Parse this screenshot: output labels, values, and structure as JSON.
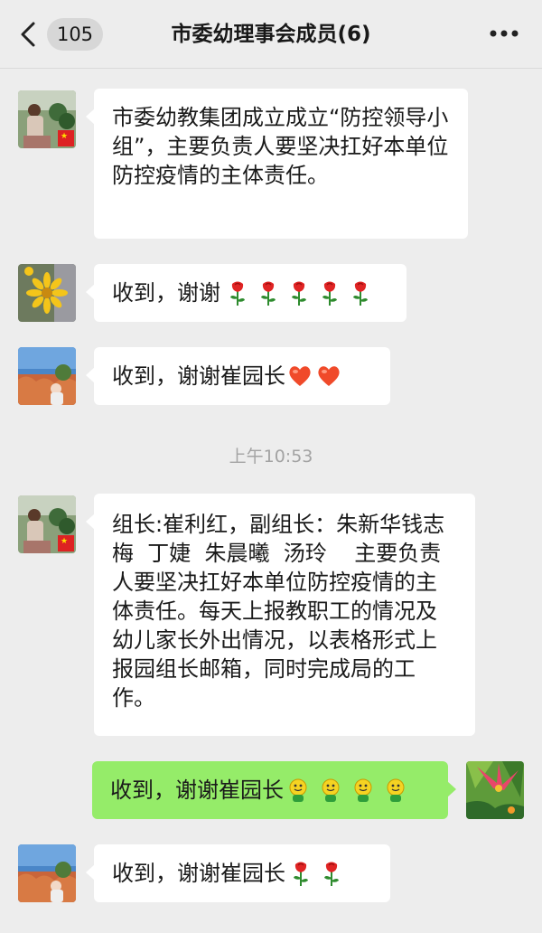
{
  "header": {
    "unread_count": "105",
    "title": "市委幼理事会成员(6)"
  },
  "messages": [
    {
      "text": "市委幼教集团成立成立“防控领导小组”，主要负责人要坚决扛好本单位防控疫情的主体责任。"
    },
    {
      "text": "收到，谢谢",
      "emoji": "rose-emoji",
      "emoji_count": 5
    },
    {
      "text": "收到，谢谢崔园长",
      "emoji": "heart-emoji",
      "emoji_count": 2
    },
    {
      "text": "组长:崔利红，副组长：朱新华钱志梅  丁婕  朱晨曦  汤玲    主要负责人要坚决扛好本单位防控疫情的主体责任。每天上报教职工的情况及幼儿家长外出情况，以表格形式上报园组长邮箱，同时完成局的工作。"
    },
    {
      "text": "收到，谢谢崔园长",
      "emoji": "smiley-emoji",
      "emoji_count": 4
    },
    {
      "text": "收到，谢谢崔园长",
      "emoji": "rose-emoji",
      "emoji_count": 2
    }
  ],
  "timestamp": "上午10:53",
  "colors": {
    "self_bubble": "#95ec69",
    "other_bubble": "#ffffff",
    "background": "#ededed"
  }
}
